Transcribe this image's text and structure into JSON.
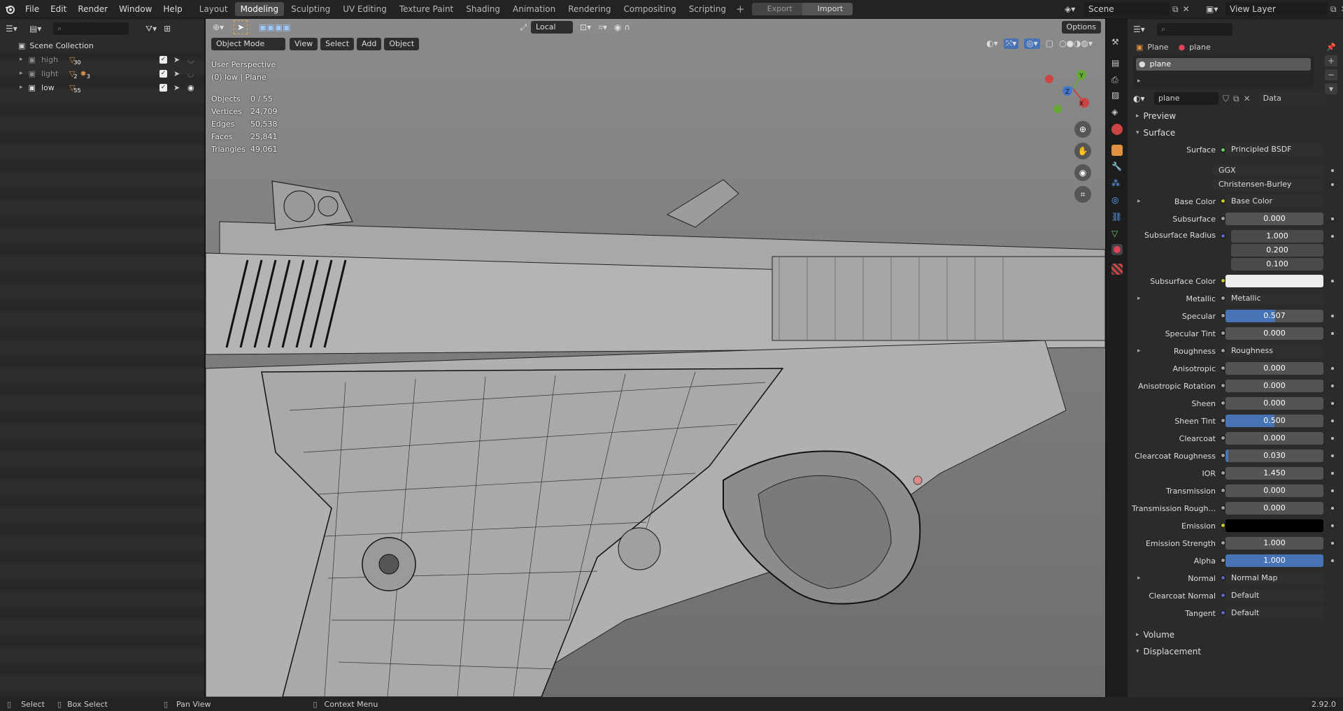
{
  "menu": {
    "items": [
      "File",
      "Edit",
      "Render",
      "Window",
      "Help"
    ]
  },
  "workspaces": [
    {
      "label": "Layout",
      "active": false
    },
    {
      "label": "Modeling",
      "active": true
    },
    {
      "label": "Sculpting",
      "active": false
    },
    {
      "label": "UV Editing",
      "active": false
    },
    {
      "label": "Texture Paint",
      "active": false
    },
    {
      "label": "Shading",
      "active": false
    },
    {
      "label": "Animation",
      "active": false
    },
    {
      "label": "Rendering",
      "active": false
    },
    {
      "label": "Compositing",
      "active": false
    },
    {
      "label": "Scripting",
      "active": false
    }
  ],
  "topbar": {
    "add_tab": "+",
    "export_label": "Export",
    "import_label": "Import",
    "scene": "Scene",
    "view_layer": "View Layer"
  },
  "outliner": {
    "collection": "Scene Collection",
    "rows": [
      {
        "name": "high",
        "count_a": "30",
        "count_b": ""
      },
      {
        "name": "light",
        "count_a": "2",
        "count_b": "3"
      },
      {
        "name": "low",
        "count_a": "55",
        "count_b": ""
      }
    ]
  },
  "viewport": {
    "mode": "Object Mode",
    "menus": [
      "View",
      "Select",
      "Add",
      "Object"
    ],
    "orientation": "Local",
    "options": "Options",
    "perspective": "User Perspective",
    "context": "(0) low | Plane",
    "stats": [
      {
        "k": "Objects",
        "v": "0 / 55"
      },
      {
        "k": "Vertices",
        "v": "24,709"
      },
      {
        "k": "Edges",
        "v": "50,538"
      },
      {
        "k": "Faces",
        "v": "25,841"
      },
      {
        "k": "Triangles",
        "v": "49,061"
      }
    ],
    "gizmo": {
      "x": "X",
      "y": "Y",
      "z": "Z"
    }
  },
  "props": {
    "breadcrumb_obj": "Plane",
    "breadcrumb_mat": "plane",
    "slot": "plane",
    "material": "plane",
    "link": "Data",
    "sections": {
      "preview": "Preview",
      "surface": "Surface",
      "volume": "Volume",
      "displacement": "Displacement"
    },
    "surface_label": "Surface",
    "surface_value": "Principled BSDF",
    "distribution": "GGX",
    "subsurface_method": "Christensen-Burley",
    "rows": [
      {
        "label": "Base Color",
        "type": "link",
        "value": "Base Color",
        "socket": "#c7c729",
        "expand": true
      },
      {
        "label": "Subsurface",
        "type": "num",
        "value": "0.000",
        "fill": 0,
        "socket": "#a1a1a1"
      },
      {
        "label": "Subsurface Radius",
        "type": "vec",
        "values": [
          "1.000",
          "0.200",
          "0.100"
        ],
        "socket": "#6363c7"
      },
      {
        "label": "Subsurface Color",
        "type": "color",
        "color": "#ededed",
        "socket": "#c7c729"
      },
      {
        "label": "Metallic",
        "type": "link",
        "value": "Metallic",
        "socket": "#a1a1a1",
        "expand": true
      },
      {
        "label": "Specular",
        "type": "num",
        "value": "0.507",
        "fill": 0.507,
        "socket": "#a1a1a1"
      },
      {
        "label": "Specular Tint",
        "type": "num",
        "value": "0.000",
        "fill": 0,
        "socket": "#a1a1a1"
      },
      {
        "label": "Roughness",
        "type": "link",
        "value": "Roughness",
        "socket": "#a1a1a1",
        "expand": true
      },
      {
        "label": "Anisotropic",
        "type": "num",
        "value": "0.000",
        "fill": 0,
        "socket": "#a1a1a1"
      },
      {
        "label": "Anisotropic Rotation",
        "type": "num",
        "value": "0.000",
        "fill": 0,
        "socket": "#a1a1a1"
      },
      {
        "label": "Sheen",
        "type": "num",
        "value": "0.000",
        "fill": 0,
        "socket": "#a1a1a1"
      },
      {
        "label": "Sheen Tint",
        "type": "num",
        "value": "0.500",
        "fill": 0.5,
        "socket": "#a1a1a1"
      },
      {
        "label": "Clearcoat",
        "type": "num",
        "value": "0.000",
        "fill": 0,
        "socket": "#a1a1a1"
      },
      {
        "label": "Clearcoat Roughness",
        "type": "num",
        "value": "0.030",
        "fill": 0.03,
        "socket": "#a1a1a1"
      },
      {
        "label": "IOR",
        "type": "num",
        "value": "1.450",
        "fill": 0,
        "socket": "#a1a1a1"
      },
      {
        "label": "Transmission",
        "type": "num",
        "value": "0.000",
        "fill": 0,
        "socket": "#a1a1a1"
      },
      {
        "label": "Transmission Rough...",
        "type": "num",
        "value": "0.000",
        "fill": 0,
        "socket": "#a1a1a1"
      },
      {
        "label": "Emission",
        "type": "color",
        "color": "#000000",
        "socket": "#c7c729"
      },
      {
        "label": "Emission Strength",
        "type": "num",
        "value": "1.000",
        "fill": 0,
        "socket": "#a1a1a1"
      },
      {
        "label": "Alpha",
        "type": "num",
        "value": "1.000",
        "fill": 1,
        "socket": "#a1a1a1"
      },
      {
        "label": "Normal",
        "type": "link",
        "value": "Normal Map",
        "socket": "#6363c7",
        "expand": true
      },
      {
        "label": "Clearcoat Normal",
        "type": "link",
        "value": "Default",
        "socket": "#6363c7"
      },
      {
        "label": "Tangent",
        "type": "link",
        "value": "Default",
        "socket": "#6363c7"
      }
    ]
  },
  "statusbar": {
    "select": "Select",
    "box_select": "Box Select",
    "pan": "Pan View",
    "context": "Context Menu",
    "version": "2.92.0"
  }
}
